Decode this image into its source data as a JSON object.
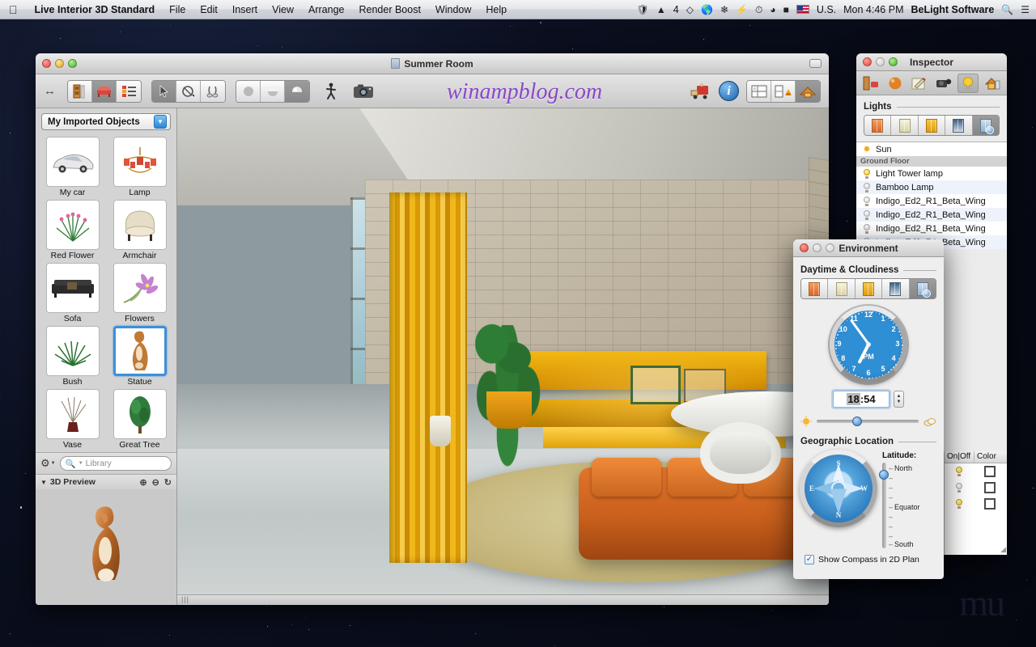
{
  "menubar": {
    "apple_icon": "apple-logo",
    "app_name": "Live Interior 3D Standard",
    "items": [
      "File",
      "Edit",
      "Insert",
      "View",
      "Arrange",
      "Render Boost",
      "Window",
      "Help"
    ],
    "right": {
      "dropbox_count": "4",
      "input_source": "U.S.",
      "clock": "Mon 4:46 PM",
      "user": "BeLight Software",
      "search_icon": "search-icon",
      "notification_icon": "notification-center-icon"
    }
  },
  "main_window": {
    "title": "Summer Room",
    "watermark": "winampblog.com",
    "toolbar": {
      "resize_icon": "horizontal-resize-icon",
      "group_build": [
        "wall-tool",
        "furniture-tool",
        "properties-list-tool"
      ],
      "group_build_selected": 1,
      "group_select": [
        "arrow-select-tool",
        "rotate-tool",
        "measure-tool"
      ],
      "group_select_selected": 0,
      "group_render": [
        "render-draft",
        "render-medium",
        "render-high"
      ],
      "group_render_selected": 2,
      "walkthrough_icon": "walkthrough-person-icon",
      "camera_icon": "camera-icon",
      "transport_icon": "moving-truck-icon",
      "info_icon": "info-button",
      "group_view": [
        "view-2d-plan",
        "view-split",
        "view-3d"
      ],
      "group_view_selected": 2
    }
  },
  "sidebar": {
    "category": "My Imported Objects",
    "objects": [
      {
        "label": "My car",
        "icon": "car-thumbnail"
      },
      {
        "label": "Lamp",
        "icon": "chandelier-thumbnail"
      },
      {
        "label": "Red Flower",
        "icon": "red-flower-thumbnail"
      },
      {
        "label": "Armchair",
        "icon": "armchair-thumbnail"
      },
      {
        "label": "Sofa",
        "icon": "sofa-thumbnail"
      },
      {
        "label": "Flowers",
        "icon": "flowers-thumbnail"
      },
      {
        "label": "Bush",
        "icon": "bush-thumbnail"
      },
      {
        "label": "Statue",
        "icon": "statue-thumbnail"
      },
      {
        "label": "Vase",
        "icon": "vase-thumbnail"
      },
      {
        "label": "Great Tree",
        "icon": "great-tree-thumbnail"
      }
    ],
    "selected_object": "Statue",
    "gear_icon": "gear-icon",
    "search_placeholder": "Library",
    "search_value": "",
    "preview_title": "3D Preview",
    "preview_tools": [
      "zoom-in-icon",
      "zoom-out-icon",
      "rotate-icon"
    ]
  },
  "inspector": {
    "title": "Inspector",
    "tabs": [
      "object-inspector-tab",
      "material-inspector-tab",
      "edit-inspector-tab",
      "camera-inspector-tab",
      "light-inspector-tab",
      "site-inspector-tab"
    ],
    "selected_tab": 4,
    "section_title": "Lights",
    "presets": [
      "preset-sunrise",
      "preset-day",
      "preset-sunset",
      "preset-night",
      "preset-custom-time"
    ],
    "selected_preset": 4,
    "lights": [
      {
        "name": "Sun",
        "type": "sun",
        "on": true
      },
      {
        "name": "Ground Floor",
        "type": "group"
      },
      {
        "name": "Light Tower lamp",
        "type": "lamp",
        "on": true
      },
      {
        "name": "Bamboo Lamp",
        "type": "lamp",
        "on": false
      },
      {
        "name": "Indigo_Ed2_R1_Beta_Wing",
        "type": "lamp",
        "on": false
      },
      {
        "name": "Indigo_Ed2_R1_Beta_Wing",
        "type": "lamp",
        "on": false
      },
      {
        "name": "Indigo_Ed2_R1_Beta_Wing",
        "type": "lamp",
        "on": false
      },
      {
        "name": "Indigo_Ed2_R1_Beta_Wing",
        "type": "lamp",
        "on": false
      }
    ]
  },
  "columns_panel": {
    "headers": [
      "On|Off",
      "Color"
    ],
    "rows": [
      {
        "on": true,
        "color": "#ffffff"
      },
      {
        "on": false,
        "color": "#ffffff"
      },
      {
        "on": true,
        "color": "#ffffff"
      }
    ]
  },
  "environment": {
    "title": "Environment",
    "daytime_section": "Daytime & Cloudiness",
    "presets": [
      "preset-sunrise",
      "preset-day",
      "preset-sunset",
      "preset-night",
      "preset-custom-time"
    ],
    "selected_preset": 4,
    "clock": {
      "numbers": [
        "12",
        "1",
        "2",
        "3",
        "4",
        "5",
        "6",
        "7",
        "8",
        "9",
        "10",
        "11"
      ],
      "ampm": "PM",
      "hour": 6,
      "minute": 54
    },
    "time_value": "18:54",
    "time_hours": "18",
    "time_minutes": ":54",
    "cloudiness": {
      "sun_icon": "sun-icon",
      "cloud_icon": "cloud-icon",
      "value_percent": 40
    },
    "geo_section": "Geographic Location",
    "compass": {
      "n": "N",
      "e": "E",
      "s": "S",
      "w": "W"
    },
    "latitude_label": "Latitude:",
    "latitude_ticks": [
      "North",
      "",
      "",
      "",
      "Equator",
      "",
      "",
      "",
      "South"
    ],
    "latitude_value_percent": 14,
    "checkbox_label": "Show Compass in 2D Plan",
    "checkbox_checked": true
  },
  "colors": {
    "accent_blue": "#3d8fd8",
    "curtain_gold": "#f0b81b",
    "sofa_orange": "#c85f1c",
    "watermark_purple": "#8b46c8"
  }
}
